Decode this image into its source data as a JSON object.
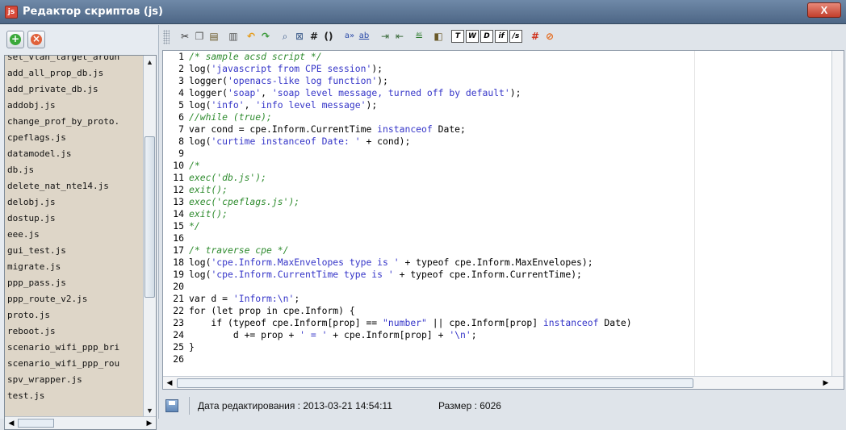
{
  "window": {
    "title": "Редактор скриптов (js)",
    "close_label": "X"
  },
  "left_toolbar": {
    "add_label": "+",
    "remove_label": "×"
  },
  "files": [
    "add_all_prop_db.js",
    "add_private_db.js",
    "addobj.js",
    "change_prof_by_proto.",
    "cpeflags.js",
    "datamodel.js",
    "db.js",
    "delete_nat_nte14.js",
    "delobj.js",
    "dostup.js",
    "eee.js",
    "gui_test.js",
    "migrate.js",
    "ppp_pass.js",
    "ppp_route_v2.js",
    "proto.js",
    "reboot.js",
    "scenario_wifi_ppp_bri",
    "scenario_wifi_ppp_rou",
    "spv_wrapper.js",
    "test.js"
  ],
  "file_list_partial_top": "set_vlan_target_aroun",
  "toolbar_icons": [
    "cut-icon",
    "copy-icon",
    "paste-icon",
    "select-all-icon",
    "undo-icon",
    "redo-icon",
    "find-icon",
    "replace-icon",
    "hash-icon",
    "parens-icon",
    "find-next-icon",
    "replace-word-icon",
    "indent-icon",
    "unindent-icon",
    "comment-icon",
    "block-icon",
    "t-icon",
    "w-icon",
    "d-icon",
    "if-icon",
    "fx-icon",
    "ban-icon",
    "stop-icon"
  ],
  "code_lines": [
    [
      {
        "t": "/* sample acsd script */",
        "c": "cmt"
      }
    ],
    [
      {
        "t": "log("
      },
      {
        "t": "'javascript from CPE session'",
        "c": "str"
      },
      {
        "t": ");"
      }
    ],
    [
      {
        "t": "logger("
      },
      {
        "t": "'openacs-like log function'",
        "c": "str"
      },
      {
        "t": ");"
      }
    ],
    [
      {
        "t": "logger("
      },
      {
        "t": "'soap'",
        "c": "str"
      },
      {
        "t": ", "
      },
      {
        "t": "'soap level message, turned off by default'",
        "c": "str"
      },
      {
        "t": ");"
      }
    ],
    [
      {
        "t": "log("
      },
      {
        "t": "'info'",
        "c": "str"
      },
      {
        "t": ", "
      },
      {
        "t": "'info level message'",
        "c": "str"
      },
      {
        "t": ");"
      }
    ],
    [
      {
        "t": "//while (true);",
        "c": "cmt"
      }
    ],
    [
      {
        "t": "var cond = cpe.Inform.CurrentTime "
      },
      {
        "t": "instanceof",
        "c": "kw"
      },
      {
        "t": " Date;"
      }
    ],
    [
      {
        "t": "log("
      },
      {
        "t": "'curtime instanceof Date: '",
        "c": "str"
      },
      {
        "t": " + cond);"
      }
    ],
    [],
    [
      {
        "t": "/*",
        "c": "cmt"
      }
    ],
    [
      {
        "t": "exec('db.js');",
        "c": "cmt"
      }
    ],
    [
      {
        "t": "exit();",
        "c": "cmt"
      }
    ],
    [
      {
        "t": "exec('cpeflags.js');",
        "c": "cmt"
      }
    ],
    [
      {
        "t": "exit();",
        "c": "cmt"
      }
    ],
    [
      {
        "t": "*/",
        "c": "cmt"
      }
    ],
    [],
    [
      {
        "t": "/* traverse cpe */",
        "c": "cmt"
      }
    ],
    [
      {
        "t": "log("
      },
      {
        "t": "'cpe.Inform.MaxEnvelopes type is '",
        "c": "str"
      },
      {
        "t": " + typeof cpe.Inform.MaxEnvelopes);"
      }
    ],
    [
      {
        "t": "log("
      },
      {
        "t": "'cpe.Inform.CurrentTime type is '",
        "c": "str"
      },
      {
        "t": " + typeof cpe.Inform.CurrentTime);"
      }
    ],
    [],
    [
      {
        "t": "var d = "
      },
      {
        "t": "'Inform:\\n'",
        "c": "str"
      },
      {
        "t": ";"
      }
    ],
    [
      {
        "t": "for (let prop in cpe.Inform) {"
      }
    ],
    [
      {
        "t": "    if (typeof cpe.Inform[prop] == "
      },
      {
        "t": "\"number\"",
        "c": "str"
      },
      {
        "t": " || cpe.Inform[prop] "
      },
      {
        "t": "instanceof",
        "c": "kw"
      },
      {
        "t": " Date)"
      }
    ],
    [
      {
        "t": "        d += prop + "
      },
      {
        "t": "' = '",
        "c": "str"
      },
      {
        "t": " + cpe.Inform[prop] + "
      },
      {
        "t": "'\\n'",
        "c": "str"
      },
      {
        "t": ";"
      }
    ],
    [
      {
        "t": "}"
      }
    ],
    []
  ],
  "status": {
    "edit_date": "Дата редактирования : 2013-03-21 14:54:11",
    "size": "Размер : 6026"
  }
}
